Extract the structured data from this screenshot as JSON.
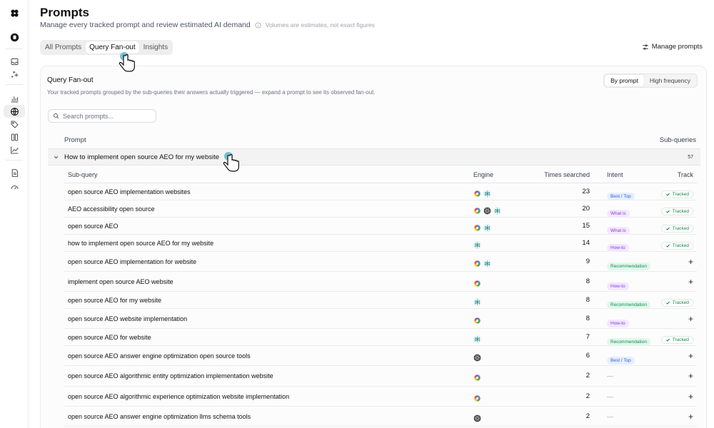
{
  "header": {
    "title": "Prompts",
    "subtitle": "Manage every tracked prompt and review estimated AI demand",
    "note": "Volumes are estimates, not exact figures"
  },
  "tabs": [
    {
      "label": "All Prompts",
      "active": false
    },
    {
      "label": "Query Fan-out",
      "active": true
    },
    {
      "label": "Insights",
      "active": false
    }
  ],
  "manage_label": "Manage prompts",
  "panel": {
    "title": "Query Fan-out",
    "description": "Your tracked prompts grouped by the sub-queries their answers actually triggered — expand a prompt to see its observed fan-out.",
    "segment": [
      "By prompt",
      "High frequency"
    ],
    "search_placeholder": "Search prompts...",
    "col_prompt": "Prompt",
    "col_subqueries": "Sub-queries",
    "prompt": {
      "text": "How to implement open source AEO for my website",
      "count": "57"
    }
  },
  "table": {
    "headers": {
      "subquery": "Sub-query",
      "engine": "Engine",
      "times": "Times searched",
      "intent": "Intent",
      "track": "Track"
    },
    "rows": [
      {
        "q": "open source AEO implementation websites",
        "engines": [
          "gemini",
          "perplexity"
        ],
        "times": "23",
        "intent": "Best / Top",
        "intent_kind": "best",
        "tracked": true
      },
      {
        "q": "AEO accessibility open source",
        "engines": [
          "gemini",
          "openai",
          "perplexity"
        ],
        "times": "20",
        "intent": "What is",
        "intent_kind": "what",
        "tracked": true
      },
      {
        "q": "open source AEO",
        "engines": [
          "gemini",
          "perplexity"
        ],
        "times": "15",
        "intent": "What is",
        "intent_kind": "what",
        "tracked": true
      },
      {
        "q": "how to implement open source AEO for my website",
        "engines": [
          "perplexity"
        ],
        "times": "14",
        "intent": "How-to",
        "intent_kind": "how",
        "tracked": true
      },
      {
        "q": "open source AEO implementation for website",
        "engines": [
          "gemini",
          "perplexity"
        ],
        "times": "9",
        "intent": "Recommendation",
        "intent_kind": "rec",
        "tracked": false
      },
      {
        "q": "implement open source AEO website",
        "engines": [
          "gemini"
        ],
        "times": "8",
        "intent": "How-to",
        "intent_kind": "how",
        "tracked": false
      },
      {
        "q": "open source AEO for my website",
        "engines": [
          "perplexity"
        ],
        "times": "8",
        "intent": "Recommendation",
        "intent_kind": "rec",
        "tracked": true
      },
      {
        "q": "open source AEO website implementation",
        "engines": [
          "gemini"
        ],
        "times": "8",
        "intent": "How-to",
        "intent_kind": "how",
        "tracked": false
      },
      {
        "q": "open source AEO for website",
        "engines": [
          "perplexity"
        ],
        "times": "7",
        "intent": "Recommendation",
        "intent_kind": "rec",
        "tracked": true
      },
      {
        "q": "open source AEO answer engine optimization open source tools",
        "engines": [
          "openai"
        ],
        "times": "6",
        "intent": "Best / Top",
        "intent_kind": "best",
        "tracked": false
      },
      {
        "q": "open source AEO algorithmic entity optimization implementation website",
        "engines": [
          "gemini"
        ],
        "times": "2",
        "intent": "",
        "intent_kind": "none",
        "tracked": false
      },
      {
        "q": "open source AEO algorithmic experience optimization website implementation",
        "engines": [
          "gemini"
        ],
        "times": "2",
        "intent": "",
        "intent_kind": "none",
        "tracked": false
      },
      {
        "q": "open source AEO answer engine optimization llms schema tools",
        "engines": [
          "openai"
        ],
        "times": "2",
        "intent": "",
        "intent_kind": "none",
        "tracked": false
      }
    ],
    "tracked_label": "Tracked",
    "empty_intent": "—",
    "add_symbol": "+"
  },
  "colors": {
    "accent_cursor": "#5fb8c4",
    "tracked_green": "#16874f"
  }
}
